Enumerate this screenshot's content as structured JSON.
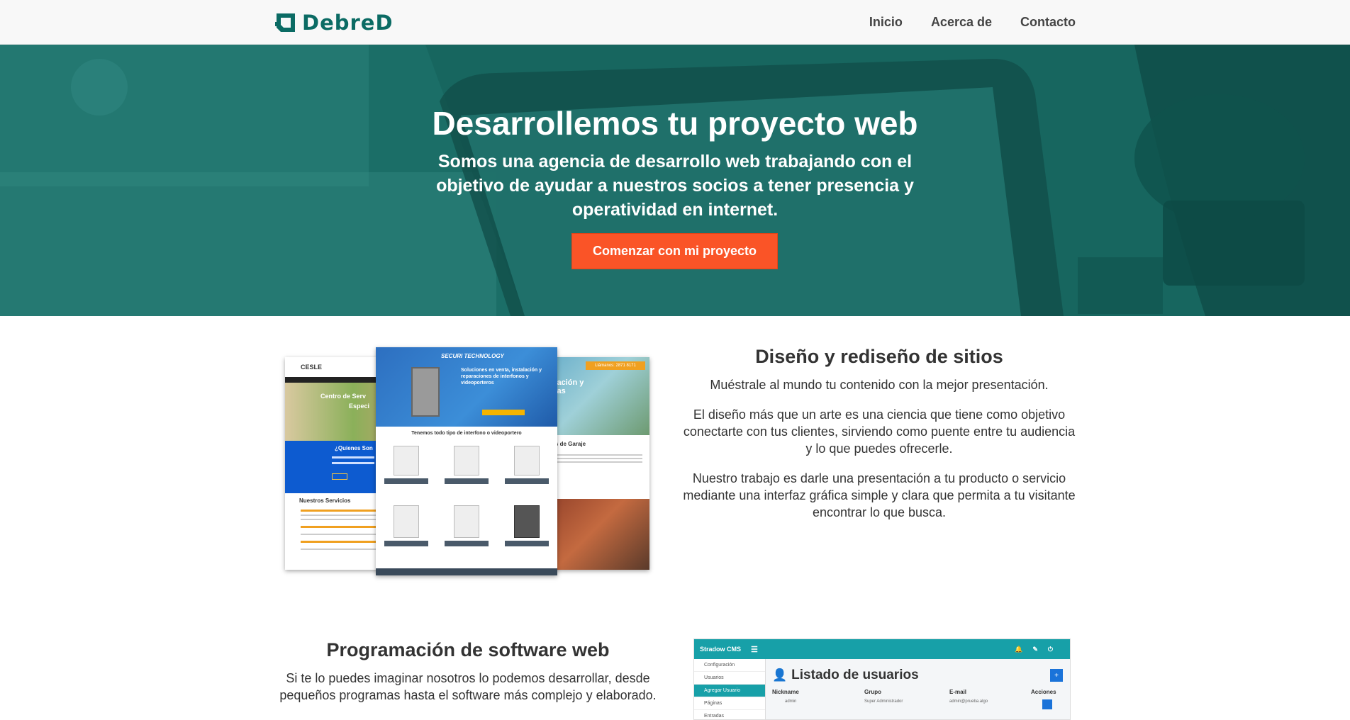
{
  "brand": {
    "name": "DebreD",
    "color": "#0b6b64"
  },
  "nav": {
    "items": [
      "Inicio",
      "Acerca de",
      "Contacto"
    ]
  },
  "hero": {
    "title": "Desarrollemos tu proyecto web",
    "subtitle": "Somos una agencia de desarrollo web trabajando con el objetivo de ayudar a nuestros socios a tener presencia y operatividad en internet.",
    "cta": "Comenzar con mi proyecto",
    "overlay_color": "#1c6f68",
    "cta_color": "#fa5427"
  },
  "section_design": {
    "title": "Diseño y rediseño de sitios",
    "p1": "Muéstrale al mundo tu contenido con la mejor presentación.",
    "p2": "El diseño más que un arte es una ciencia que tiene como objetivo conectarte con tus clientes, sirviendo como puente entre tu audiencia y lo que puedes ofrecerle.",
    "p3": "Nuestro trabajo es darle una presentación a tu producto o servicio mediante una interfaz gráfica simple y clara que permita a tu visitante encontrar lo que busca.",
    "mockups": {
      "left": {
        "logo": "CESLE",
        "heading": "Centro de Serv",
        "sub": "Especi",
        "who": "¿Quienes Son",
        "services": "Nuestros Servicios"
      },
      "center": {
        "brand": "SECURI TECHNOLOGY",
        "headline": "Soluciones en venta, instalación y reparaciones de interfonos y videoporteros",
        "body": "Tenemos todo tipo de interfono o videoportero"
      },
      "right": {
        "badge": "Llámanos: 2871 8171",
        "heading": "reparación y puertas",
        "section": "Puertas de Garaje"
      }
    }
  },
  "section_software": {
    "title": "Programación de software web",
    "p1": "Si te lo puedes imaginar nosotros lo podemos desarrollar, desde pequeños programas hasta el software más complejo y elaborado.",
    "cms": {
      "app_name": "Stradow CMS",
      "sidebar": [
        "Configuración",
        "Usuarios",
        "Agregar Usuario",
        "Páginas",
        "Entradas"
      ],
      "heading": "Listado de usuarios",
      "columns": [
        "Nickname",
        "Grupo",
        "E-mail",
        "Acciones"
      ],
      "row": [
        "admin",
        "Super Administrador",
        "admin@prueba.algo"
      ]
    }
  }
}
